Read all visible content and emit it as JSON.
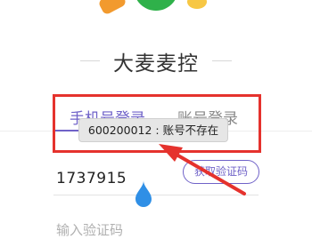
{
  "app": {
    "title": "大麦麦控"
  },
  "tabs": [
    {
      "label": "手机号登录",
      "active": true
    },
    {
      "label": "账号登录",
      "active": false
    }
  ],
  "login": {
    "phone_value": "1737915",
    "get_code_label": "获取验证码",
    "code_placeholder": "输入验证码"
  },
  "toast": {
    "message": "600200012 : 账号不存在"
  },
  "colors": {
    "accent": "#6f62c8",
    "annotation_red": "#e5322d",
    "drop_handle": "#2f8fe6"
  }
}
